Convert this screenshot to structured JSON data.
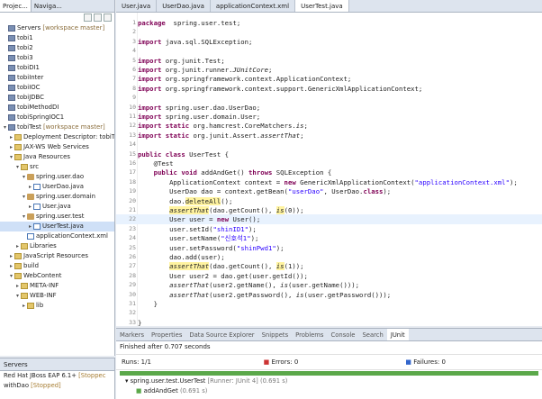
{
  "left_tabs": [
    "Projec...",
    "Naviga..."
  ],
  "tree": [
    {
      "indent": 0,
      "twisty": "",
      "icon": "proj",
      "text": "Servers",
      "ann": " [workspace master]"
    },
    {
      "indent": 0,
      "twisty": "",
      "icon": "proj",
      "text": "tobi1",
      "ann": ""
    },
    {
      "indent": 0,
      "twisty": "",
      "icon": "proj",
      "text": "tobi2",
      "ann": ""
    },
    {
      "indent": 0,
      "twisty": "",
      "icon": "proj",
      "text": "tobi3",
      "ann": ""
    },
    {
      "indent": 0,
      "twisty": "",
      "icon": "proj",
      "text": "tobiDI1",
      "ann": ""
    },
    {
      "indent": 0,
      "twisty": "",
      "icon": "proj",
      "text": "tobiInter",
      "ann": ""
    },
    {
      "indent": 0,
      "twisty": "",
      "icon": "proj",
      "text": "tobiIOC",
      "ann": ""
    },
    {
      "indent": 0,
      "twisty": "",
      "icon": "proj",
      "text": "tobiJDBC",
      "ann": ""
    },
    {
      "indent": 0,
      "twisty": "",
      "icon": "proj",
      "text": "tobiMethodDI",
      "ann": ""
    },
    {
      "indent": 0,
      "twisty": "",
      "icon": "proj",
      "text": "tobiSpringIOC1",
      "ann": ""
    },
    {
      "indent": 0,
      "twisty": "▾",
      "icon": "proj",
      "text": "tobiTest",
      "ann": " [workspace master]"
    },
    {
      "indent": 1,
      "twisty": "▸",
      "icon": "fold",
      "text": "Deployment Descriptor: tobiTe",
      "ann": ""
    },
    {
      "indent": 1,
      "twisty": "▸",
      "icon": "fold",
      "text": "JAX-WS Web Services",
      "ann": ""
    },
    {
      "indent": 1,
      "twisty": "▾",
      "icon": "fold",
      "text": "Java Resources",
      "ann": ""
    },
    {
      "indent": 2,
      "twisty": "▾",
      "icon": "fold",
      "text": "src",
      "ann": ""
    },
    {
      "indent": 3,
      "twisty": "▾",
      "icon": "pkg",
      "text": "spring.user.dao",
      "ann": ""
    },
    {
      "indent": 4,
      "twisty": "▸",
      "icon": "jfile",
      "text": "UserDao.java",
      "ann": ""
    },
    {
      "indent": 3,
      "twisty": "▾",
      "icon": "pkg",
      "text": "spring.user.domain",
      "ann": ""
    },
    {
      "indent": 4,
      "twisty": "▸",
      "icon": "jfile",
      "text": "User.java",
      "ann": ""
    },
    {
      "indent": 3,
      "twisty": "▾",
      "icon": "pkg",
      "text": "spring.user.test",
      "ann": ""
    },
    {
      "indent": 4,
      "twisty": "▸",
      "icon": "jfile",
      "text": "UserTest.java",
      "ann": "",
      "sel": true
    },
    {
      "indent": 3,
      "twisty": "",
      "icon": "jfile",
      "text": "applicationContext.xml",
      "ann": ""
    },
    {
      "indent": 2,
      "twisty": "▸",
      "icon": "fold",
      "text": "Libraries",
      "ann": ""
    },
    {
      "indent": 1,
      "twisty": "▸",
      "icon": "fold",
      "text": "JavaScript Resources",
      "ann": ""
    },
    {
      "indent": 1,
      "twisty": "▸",
      "icon": "fold",
      "text": "build",
      "ann": ""
    },
    {
      "indent": 1,
      "twisty": "▾",
      "icon": "fold",
      "text": "WebContent",
      "ann": ""
    },
    {
      "indent": 2,
      "twisty": "▸",
      "icon": "fold",
      "text": "META-INF",
      "ann": ""
    },
    {
      "indent": 2,
      "twisty": "▾",
      "icon": "fold",
      "text": "WEB-INF",
      "ann": ""
    },
    {
      "indent": 3,
      "twisty": "▸",
      "icon": "fold",
      "text": "lib",
      "ann": ""
    }
  ],
  "servers": {
    "tab": "Servers",
    "rows": [
      {
        "text": "Red Hat JBoss EAP 6.1+",
        "status": " [Stoppec"
      },
      {
        "text": "withDao",
        "status": " [Stopped]"
      }
    ]
  },
  "editor_tabs": [
    {
      "label": "User.java",
      "active": false
    },
    {
      "label": "UserDao.java",
      "active": false
    },
    {
      "label": "applicationContext.xml",
      "active": false
    },
    {
      "label": "UserTest.java",
      "active": true
    }
  ],
  "code": [
    {
      "n": "1",
      "s": [
        [
          "kw",
          "package"
        ],
        [
          "",
          "  spring.user.test;"
        ]
      ]
    },
    {
      "n": "2",
      "s": []
    },
    {
      "n": "3",
      "s": [
        [
          "kw",
          "import"
        ],
        [
          "",
          " java.sql.SQLException;"
        ]
      ]
    },
    {
      "n": "4",
      "s": []
    },
    {
      "n": "5",
      "s": [
        [
          "kw",
          "import"
        ],
        [
          "",
          " org.junit.Test;"
        ]
      ]
    },
    {
      "n": "6",
      "s": [
        [
          "kw",
          "import"
        ],
        [
          "",
          " org.junit.runner."
        ],
        [
          "it",
          "JUnitCore"
        ],
        [
          "",
          ";"
        ]
      ]
    },
    {
      "n": "7",
      "s": [
        [
          "kw",
          "import"
        ],
        [
          "",
          " org.springframework.context.ApplicationContext;"
        ]
      ]
    },
    {
      "n": "8",
      "s": [
        [
          "kw",
          "import"
        ],
        [
          "",
          " org.springframework.context.support.GenericXmlApplicationContext;"
        ]
      ]
    },
    {
      "n": "9",
      "s": []
    },
    {
      "n": "10",
      "s": [
        [
          "kw",
          "import"
        ],
        [
          "",
          " spring.user.dao.UserDao;"
        ]
      ]
    },
    {
      "n": "11",
      "s": [
        [
          "kw",
          "import"
        ],
        [
          "",
          " spring.user.domain.User;"
        ]
      ]
    },
    {
      "n": "12",
      "s": [
        [
          "kw",
          "import static"
        ],
        [
          "",
          " org.hamcrest.CoreMatchers."
        ],
        [
          "it",
          "is"
        ],
        [
          "",
          ";"
        ]
      ]
    },
    {
      "n": "13",
      "s": [
        [
          "kw",
          "import static"
        ],
        [
          "",
          " org.junit.Assert."
        ],
        [
          "it",
          "assertThat"
        ],
        [
          "",
          ";"
        ]
      ]
    },
    {
      "n": "14",
      "s": []
    },
    {
      "n": "15",
      "s": [
        [
          "kw",
          "public class"
        ],
        [
          "",
          " UserTest {"
        ]
      ]
    },
    {
      "n": "16",
      "s": [
        [
          "",
          "    @Test"
        ]
      ]
    },
    {
      "n": "17",
      "s": [
        [
          "kw",
          "    public void"
        ],
        [
          "",
          " addAndGet() "
        ],
        [
          "kw",
          "throws"
        ],
        [
          "",
          " SQLException {"
        ]
      ]
    },
    {
      "n": "18",
      "s": [
        [
          "",
          "        ApplicationContext context = "
        ],
        [
          "kw",
          "new"
        ],
        [
          "",
          " GenericXmlApplicationContext("
        ],
        [
          "str",
          "\"applicationContext.xml\""
        ],
        [
          "",
          ");"
        ]
      ]
    },
    {
      "n": "19",
      "s": [
        [
          "",
          "        UserDao dao = context.getBean("
        ],
        [
          "str",
          "\"userDao\""
        ],
        [
          "",
          ", UserDao."
        ],
        [
          "kw",
          "class"
        ],
        [
          "",
          ");"
        ]
      ]
    },
    {
      "n": "20",
      "s": [
        [
          "",
          "        dao."
        ],
        [
          "hl",
          "deleteAll"
        ],
        [
          "",
          "();"
        ]
      ]
    },
    {
      "n": "21",
      "s": [
        [
          "",
          "        "
        ],
        [
          "hl it",
          "assertThat"
        ],
        [
          "",
          "(dao.getCount(), "
        ],
        [
          "hl it",
          "is"
        ],
        [
          "",
          "(0));"
        ]
      ]
    },
    {
      "n": "22",
      "s": [
        [
          "",
          "        User user = "
        ],
        [
          "kw",
          "new"
        ],
        [
          "",
          " User();"
        ]
      ],
      "cur": true
    },
    {
      "n": "23",
      "s": [
        [
          "",
          "        user.setId("
        ],
        [
          "str",
          "\"shinID1\""
        ],
        [
          "",
          ");"
        ]
      ]
    },
    {
      "n": "24",
      "s": [
        [
          "",
          "        user.setName("
        ],
        [
          "str",
          "\"신호석1\""
        ],
        [
          "",
          ");"
        ]
      ]
    },
    {
      "n": "25",
      "s": [
        [
          "",
          "        user.setPassword("
        ],
        [
          "str",
          "\"shinPwd1\""
        ],
        [
          "",
          ");"
        ]
      ]
    },
    {
      "n": "26",
      "s": [
        [
          "",
          "        dao.add(user);"
        ]
      ]
    },
    {
      "n": "27",
      "s": [
        [
          "",
          "        "
        ],
        [
          "hl it",
          "assertThat"
        ],
        [
          "",
          "(dao.getCount(), "
        ],
        [
          "hl it",
          "is"
        ],
        [
          "",
          "(1));"
        ]
      ]
    },
    {
      "n": "28",
      "s": [
        [
          "",
          "        User user2 = dao.get(user.getId());"
        ]
      ]
    },
    {
      "n": "29",
      "s": [
        [
          "",
          "        "
        ],
        [
          "it",
          "assertThat"
        ],
        [
          "",
          "(user2.getName(), "
        ],
        [
          "it",
          "is"
        ],
        [
          "",
          "(user.getName()));"
        ]
      ]
    },
    {
      "n": "30",
      "s": [
        [
          "",
          "        "
        ],
        [
          "it",
          "assertThat"
        ],
        [
          "",
          "(user2.getPassword(), "
        ],
        [
          "it",
          "is"
        ],
        [
          "",
          "(user.getPassword()));"
        ]
      ]
    },
    {
      "n": "31",
      "s": [
        [
          "",
          "    }"
        ]
      ]
    },
    {
      "n": "32",
      "s": []
    },
    {
      "n": "33",
      "s": [
        [
          "",
          "}"
        ]
      ]
    }
  ],
  "bottom_tabs": [
    "Markers",
    "Properties",
    "Data Source Explorer",
    "Snippets",
    "Problems",
    "Console",
    "Search",
    "JUnit"
  ],
  "junit": {
    "status": "Finished after 0.707 seconds",
    "runs_label": "Runs:",
    "runs_value": "1/1",
    "errors_label": "Errors:",
    "errors_value": "0",
    "failures_label": "Failures:",
    "failures_value": "0",
    "bar_color": "#5ba84a",
    "suite": "spring.user.test.UserTest",
    "suite_detail": " [Runner: JUnit 4] (0.691 s)",
    "test": "addAndGet",
    "test_time": " (0.691 s)"
  }
}
